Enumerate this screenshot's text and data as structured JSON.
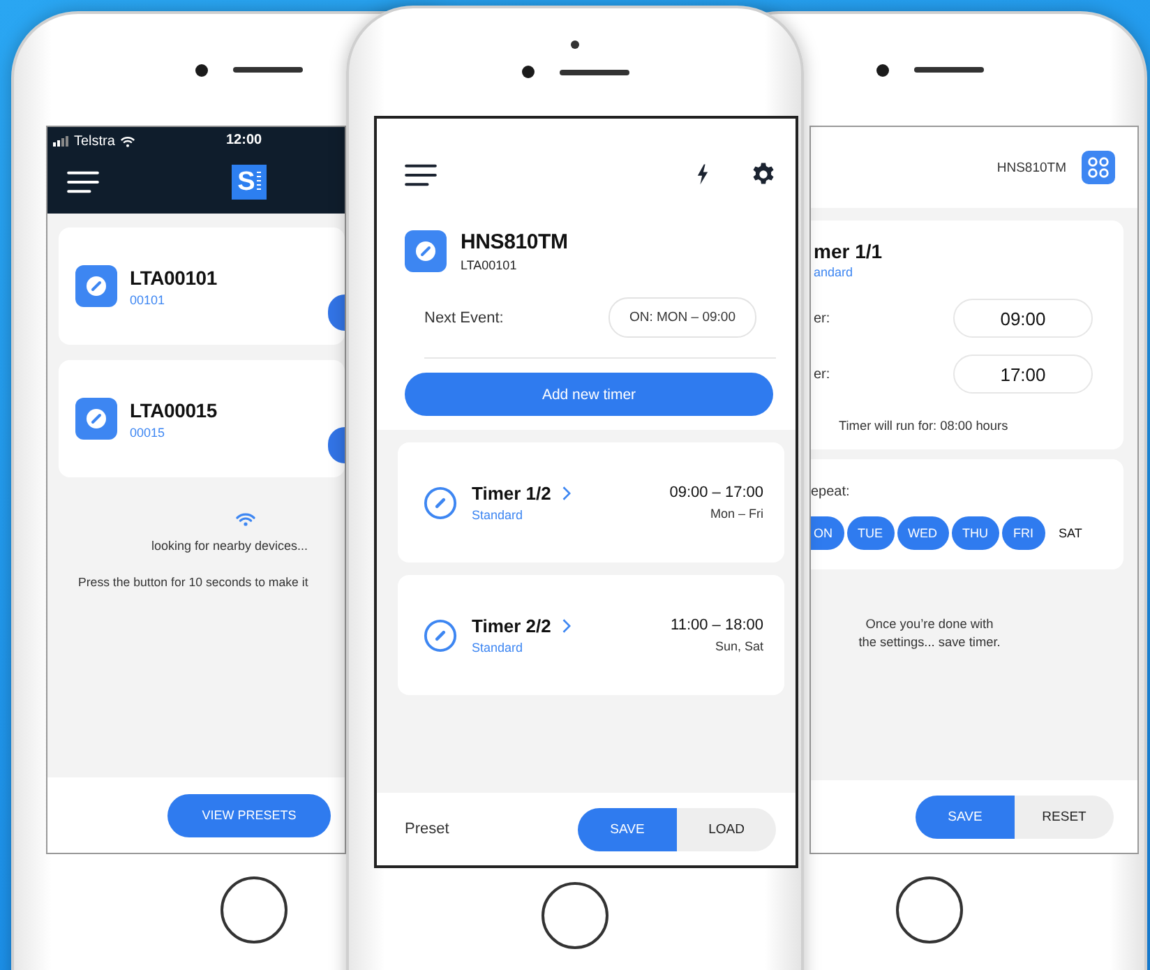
{
  "phones": [
    {
      "kind": "devices",
      "status_bar": {
        "carrier": "Telstra",
        "time": "12:00"
      },
      "logo": "S",
      "devices": [
        {
          "name": "LTA00101",
          "code": "00101"
        },
        {
          "name": "LTA00015",
          "code": "00015"
        }
      ],
      "scan_message": "looking for nearby devices...",
      "hint": "Press the button for 10 seconds to make it",
      "button": "VIEW PRESETS"
    },
    {
      "kind": "timers",
      "device": {
        "name": "HNS810TM",
        "code": "LTA00101"
      },
      "next_event_label": "Next Event:",
      "next_event_value": "ON: MON – 09:00",
      "add_button": "Add new timer",
      "timers": [
        {
          "title": "Timer 1/2",
          "type": "Standard",
          "time": "09:00 – 17:00",
          "days": "Mon – Fri"
        },
        {
          "title": "Timer 2/2",
          "type": "Standard",
          "time": "11:00 – 18:00",
          "days": "Sun, Sat"
        }
      ],
      "footer_label": "Preset",
      "buttons": [
        {
          "label": "SAVE",
          "selected": true
        },
        {
          "label": "LOAD",
          "selected": false
        }
      ]
    },
    {
      "kind": "timer_detail",
      "device_name": "HNS810TM",
      "title": "mer 1/1",
      "type": "andard",
      "fields": [
        {
          "label": "er:",
          "value": "09:00"
        },
        {
          "label": "er:",
          "value": "17:00"
        }
      ],
      "duration": "Timer will run for: 08:00 hours",
      "repeat_label": "epeat:",
      "days": [
        {
          "label": "ON",
          "selected": true
        },
        {
          "label": "TUE",
          "selected": true
        },
        {
          "label": "WED",
          "selected": true
        },
        {
          "label": "THU",
          "selected": true
        },
        {
          "label": "FRI",
          "selected": true
        },
        {
          "label": "SAT",
          "selected": false
        }
      ],
      "note": [
        "Once you’re done with",
        "the settings... save timer."
      ],
      "buttons": [
        {
          "label": "SAVE",
          "selected": true
        },
        {
          "label": "RESET",
          "selected": false
        }
      ]
    }
  ]
}
